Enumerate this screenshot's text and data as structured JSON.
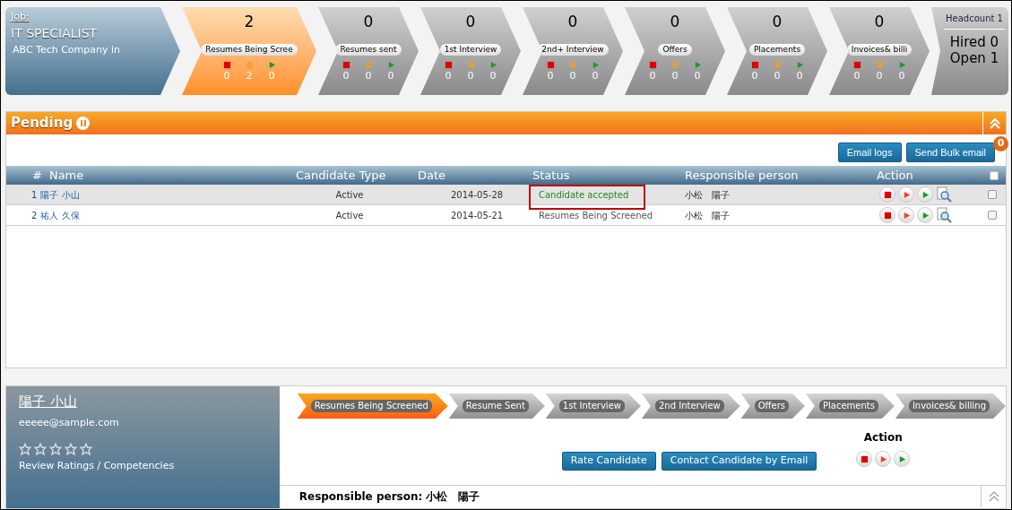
{
  "job": {
    "label": "Job:",
    "title": "IT SPECIALIST",
    "company": "ABC Tech Company in"
  },
  "stages": [
    {
      "count": "2",
      "label": "Resumes Being Scree",
      "selected": true,
      "sub_counts": [
        "0",
        "2",
        "0"
      ]
    },
    {
      "count": "0",
      "label": "Resumes sent",
      "selected": false,
      "sub_counts": [
        "0",
        "0",
        "0"
      ]
    },
    {
      "count": "0",
      "label": "1st Interview",
      "selected": false,
      "sub_counts": [
        "0",
        "0",
        "0"
      ]
    },
    {
      "count": "0",
      "label": "2nd+ Interview",
      "selected": false,
      "sub_counts": [
        "0",
        "0",
        "0"
      ]
    },
    {
      "count": "0",
      "label": "Offers",
      "selected": false,
      "sub_counts": [
        "0",
        "0",
        "0"
      ]
    },
    {
      "count": "0",
      "label": "Placements",
      "selected": false,
      "sub_counts": [
        "0",
        "0",
        "0"
      ]
    },
    {
      "count": "0",
      "label": "Invoices& billi",
      "selected": false,
      "sub_counts": [
        "0",
        "0",
        "0"
      ]
    }
  ],
  "headcount": {
    "title": "Headcount 1",
    "hired": "Hired 0",
    "open": "Open 1"
  },
  "pending": {
    "title": "Pending",
    "buttons": [
      "Email logs",
      "Send Bulk email"
    ],
    "bulk_badge": "0",
    "select_all_checked": false,
    "columns": [
      "#",
      "Name",
      "Candidate Type",
      "Date",
      "Status",
      "Responsible person",
      "Action"
    ],
    "rows": [
      {
        "number": "1",
        "name": "陽子 小山",
        "type": "Active",
        "date": "2014-05-28",
        "status": "Candidate accepted",
        "color": "#1f8a1f",
        "responsible": "小松　陽子",
        "selected": true,
        "highlighted": true,
        "checked": false
      },
      {
        "number": "2",
        "name": "祐人 久保",
        "type": "Active",
        "date": "2014-05-21",
        "status": "Resumes Being Screened",
        "color": "#555555",
        "responsible": "小松　陽子",
        "selected": false,
        "highlighted": false,
        "checked": false
      }
    ]
  },
  "candidate": {
    "name": "陽子 小山",
    "email": "eeeee@sample.com",
    "stars": 0,
    "ratings_link": "Review Ratings / Competencies",
    "steps": [
      {
        "label": "Resumes Being Screened",
        "selected": true
      },
      {
        "label": "Resume Sent",
        "selected": false
      },
      {
        "label": "1st Interview",
        "selected": false
      },
      {
        "label": "2nd Interview",
        "selected": false
      },
      {
        "label": "Offers",
        "selected": false
      },
      {
        "label": "Placements",
        "selected": false
      },
      {
        "label": "Invoices& billing",
        "selected": false
      }
    ],
    "buttons": [
      "Rate Candidate",
      "Contact Candidate by Email"
    ],
    "action_label": "Action",
    "responsible_label": "Responsible person:",
    "responsible": "小松　陽子"
  }
}
